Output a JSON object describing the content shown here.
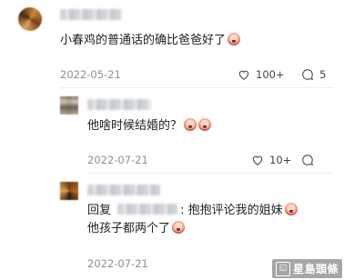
{
  "comments": [
    {
      "text": "小春鸡的普通话的确比爸爸好了",
      "date": "2022-05-21",
      "likes": "100+",
      "replies": "5"
    }
  ],
  "replies": [
    {
      "text": "他啥时候结婚的？",
      "date": "2022-07-21",
      "likes": "10+",
      "replies": ""
    },
    {
      "reply_prefix": "回复",
      "text_line1": ": 抱抱评论我的姐妹",
      "text_line2": "他孩子都两个了",
      "date": "2022-07-21"
    }
  ],
  "watermark": {
    "text": "星島頭條"
  },
  "icons": [
    "heart-icon",
    "comment-icon",
    "emoji-icon"
  ]
}
